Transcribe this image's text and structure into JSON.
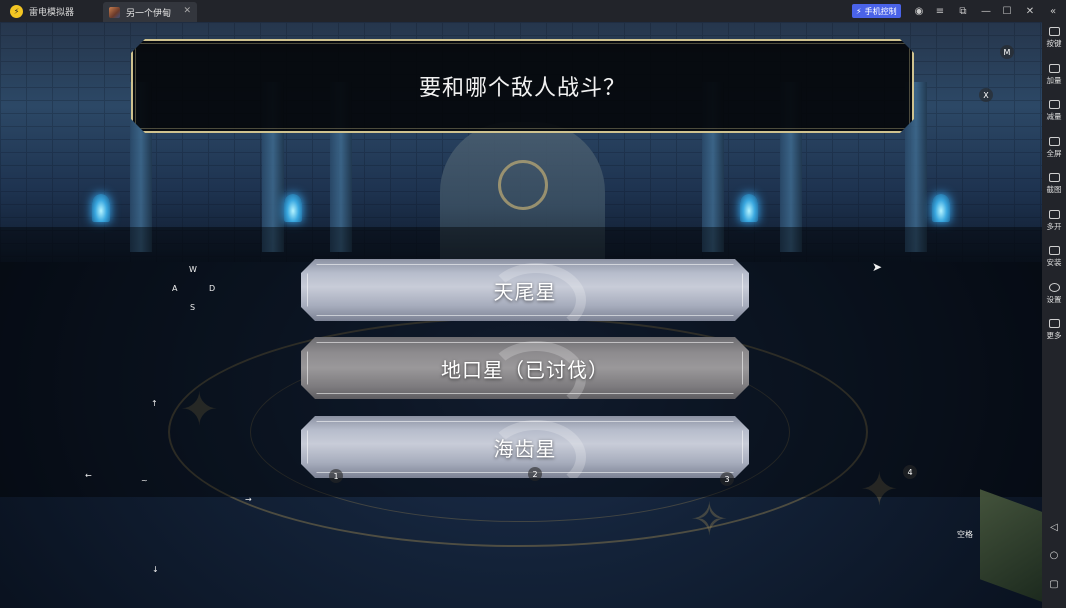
{
  "app": {
    "name": "雷电模拟器",
    "logo_text": "⚡"
  },
  "tab": {
    "title": "另一个伊甸",
    "close": "✕"
  },
  "titlebar": {
    "phone_control": "手机控制",
    "buttons": [
      "user-icon",
      "menu-icon",
      "restore-icon",
      "minimize-icon",
      "maximize-icon",
      "close-icon",
      "collapse-icon"
    ],
    "glyphs": {
      "user": "◉",
      "menu": "≡",
      "restore": "⧉",
      "minimize": "—",
      "maximize": "☐",
      "close": "✕",
      "collapse": "«"
    }
  },
  "dialog": {
    "question": "要和哪个敌人战斗？",
    "choices": [
      {
        "label": "天尾星",
        "state": "available"
      },
      {
        "label": "地口星（已讨伐）",
        "state": "defeated"
      },
      {
        "label": "海齿星",
        "state": "available"
      }
    ]
  },
  "keymap": {
    "m": "M",
    "x": "X",
    "w": "W",
    "a": "A",
    "d": "D",
    "s": "S",
    "up": "↑",
    "left": "←",
    "tilde": "~",
    "right": "→",
    "down": "↓",
    "k1": "1",
    "k2": "2",
    "k3": "3",
    "k4": "4",
    "space": "空格"
  },
  "sidebar": {
    "items": [
      {
        "label": "按键",
        "icon": "keyboard-icon"
      },
      {
        "label": "加量",
        "icon": "volume-up-icon"
      },
      {
        "label": "减量",
        "icon": "volume-down-icon"
      },
      {
        "label": "全屏",
        "icon": "fullscreen-icon"
      },
      {
        "label": "截图",
        "icon": "scissors-icon"
      },
      {
        "label": "多开",
        "icon": "multi-instance-icon"
      },
      {
        "label": "安装",
        "icon": "install-icon"
      },
      {
        "label": "设置",
        "icon": "gear-icon"
      },
      {
        "label": "更多",
        "icon": "more-icon"
      }
    ],
    "nav": {
      "back": "◁",
      "home": "○",
      "recent": "▢"
    }
  },
  "colors": {
    "accent": "#4a63e8",
    "dialog_border": "#cfc28f",
    "logo": "#f3c623"
  }
}
